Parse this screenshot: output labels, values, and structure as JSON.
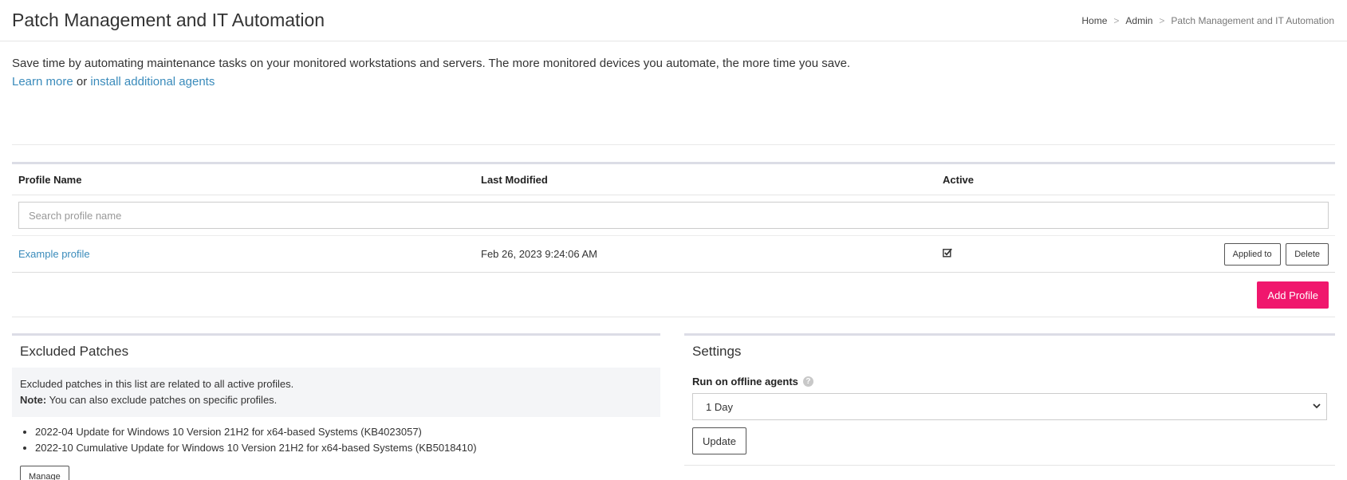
{
  "header": {
    "title": "Patch Management and IT Automation",
    "breadcrumb": [
      "Home",
      "Admin",
      "Patch Management and IT Automation"
    ],
    "breadcrumb_separator": ">"
  },
  "intro": {
    "text": "Save time by automating maintenance tasks on your monitored workstations and servers. The more monitored devices you automate, the more time you save.",
    "learn_more": "Learn more",
    "or": "or",
    "install_agents": "install additional agents"
  },
  "profiles_table": {
    "columns": [
      "Profile Name",
      "Last Modified",
      "Active"
    ],
    "search_placeholder": "Search profile name",
    "rows": [
      {
        "name": "Example profile",
        "last_modified": "Feb 26, 2023 9:24:06 AM",
        "active": true,
        "applied_to_label": "Applied to",
        "delete_label": "Delete"
      }
    ],
    "add_label": "Add Profile"
  },
  "excluded": {
    "title": "Excluded Patches",
    "info": "Excluded patches in this list are related to all active profiles.",
    "note_label": "Note:",
    "note_text": " You can also exclude patches on specific profiles.",
    "patches": [
      "2022-04 Update for Windows 10 Version 21H2 for x64-based Systems (KB4023057)",
      "2022-10 Cumulative Update for Windows 10 Version 21H2 for x64-based Systems (KB5018410)"
    ],
    "manage_label": "Manage"
  },
  "settings": {
    "title": "Settings",
    "run_offline_label": "Run on offline agents",
    "run_offline_value": "1 Day",
    "update_label": "Update"
  },
  "colors": {
    "accent": "#f0176d",
    "link": "#3a8bbb"
  }
}
